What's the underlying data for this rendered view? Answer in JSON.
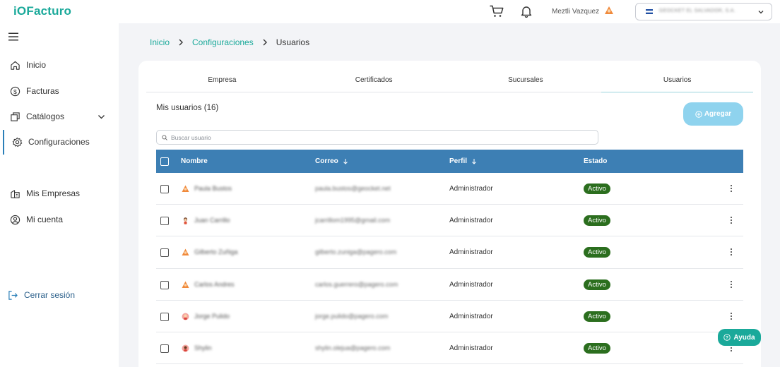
{
  "brand": {
    "logo_prefix": "iO",
    "logo_text": "Facturo",
    "accent": "#1aa99a"
  },
  "header": {
    "user_name": "Meztli Vazquez",
    "company": "GEOCKET EL SALVADOR, S.A."
  },
  "sidebar": {
    "items": [
      {
        "label": "Inicio",
        "icon": "home-icon"
      },
      {
        "label": "Facturas",
        "icon": "dollar-icon"
      },
      {
        "label": "Catálogos",
        "icon": "catalog-icon"
      },
      {
        "label": "Configuraciones",
        "icon": "gear-icon"
      },
      {
        "label": "Mis Empresas",
        "icon": "building-icon"
      },
      {
        "label": "Mi cuenta",
        "icon": "user-icon"
      },
      {
        "label": "Cerrar sesión",
        "icon": "logout-icon"
      }
    ]
  },
  "breadcrumb": {
    "items": [
      "Inicio",
      "Configuraciones"
    ],
    "current": "Usuarios"
  },
  "tabs": [
    "Empresa",
    "Certificados",
    "Sucursales",
    "Usuarios"
  ],
  "users_section": {
    "title": "Mis usuarios (16)",
    "add_label": "Agregar",
    "search_placeholder": "Buscar usuario"
  },
  "table": {
    "headers": {
      "name": "Nombre",
      "email": "Correo",
      "perfil": "Perfil",
      "estado": "Estado"
    },
    "rows": [
      {
        "name": "Paula Bustos",
        "email": "paula.bustos@geocket.net",
        "perfil": "Administrador",
        "estado": "Activo"
      },
      {
        "name": "Juan Carrillo",
        "email": "jcarrillom1995@gmail.com",
        "perfil": "Administrador",
        "estado": "Activo"
      },
      {
        "name": "Gilberto Zuñiga",
        "email": "gilberto.zuniga@pagero.com",
        "perfil": "Administrador",
        "estado": "Activo"
      },
      {
        "name": "Carlos Andres",
        "email": "carlos.guerrero@pagero.com",
        "perfil": "Administrador",
        "estado": "Activo"
      },
      {
        "name": "Jorge Pulido",
        "email": "jorge.pulido@pagero.com",
        "perfil": "Administrador",
        "estado": "Activo"
      },
      {
        "name": "Shylin",
        "email": "shylin.olejua@pagero.com",
        "perfil": "Administrador",
        "estado": "Activo"
      }
    ]
  },
  "help": {
    "label": "Ayuda"
  }
}
